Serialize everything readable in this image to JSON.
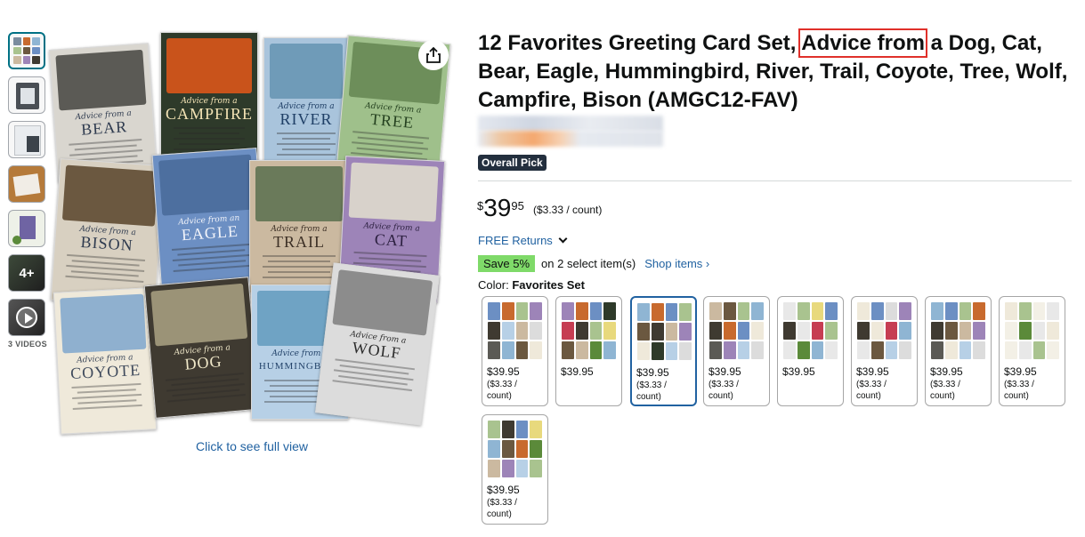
{
  "gallery": {
    "thumbnails": [
      {
        "name": "thumb-1",
        "kind": "image"
      },
      {
        "name": "thumb-2",
        "kind": "image"
      },
      {
        "name": "thumb-3",
        "kind": "image"
      },
      {
        "name": "thumb-4",
        "kind": "image"
      },
      {
        "name": "thumb-5",
        "kind": "image"
      },
      {
        "name": "thumb-more",
        "kind": "more",
        "label": "4+"
      },
      {
        "name": "thumb-video",
        "kind": "video"
      }
    ],
    "videos_label": "3 VIDEOS",
    "see_full_view": "Click to see full view",
    "share_icon": "share-icon",
    "cards": [
      {
        "adv": "Advice from a",
        "name": "BEAR",
        "bg": "#d9d6cf",
        "pic": "#5b5a55",
        "ink": "#2f3b4f"
      },
      {
        "adv": "Advice from a",
        "name": "CAMPFIRE",
        "bg": "#2e3a2a",
        "pic": "#c9531b",
        "ink": "#f3e3b5"
      },
      {
        "adv": "Advice from a",
        "name": "RIVER",
        "bg": "#a9c4dc",
        "pic": "#6f9bb8",
        "ink": "#1f3f66"
      },
      {
        "adv": "Advice from a",
        "name": "TREE",
        "bg": "#9fc08b",
        "pic": "#6d8e5a",
        "ink": "#24401f"
      },
      {
        "adv": "Advice from a",
        "name": "BISON",
        "bg": "#d8d0c1",
        "pic": "#6b5840",
        "ink": "#2f3b4f"
      },
      {
        "adv": "Advice from an",
        "name": "EAGLE",
        "bg": "#6c8fc3",
        "pic": "#4d6f9f",
        "ink": "#f2f4fa"
      },
      {
        "adv": "Advice from a",
        "name": "TRAIL",
        "bg": "#cbb9a0",
        "pic": "#6a7a5a",
        "ink": "#3d3026"
      },
      {
        "adv": "Advice from a",
        "name": "CAT",
        "bg": "#9d84b8",
        "pic": "#d8d2cb",
        "ink": "#2c2040"
      },
      {
        "adv": "Advice from a",
        "name": "COYOTE",
        "bg": "#efe9da",
        "pic": "#8fb0cf",
        "ink": "#3f4a5c"
      },
      {
        "adv": "Advice from a",
        "name": "DOG",
        "bg": "#3f3a31",
        "pic": "#9b9377",
        "ink": "#efe7c8"
      },
      {
        "adv": "Advice from a",
        "name": "HUMMINGBIRD",
        "bg": "#b7d0e6",
        "pic": "#6fa3c4",
        "ink": "#24446b"
      },
      {
        "adv": "Advice from a",
        "name": "WOLF",
        "bg": "#dcdcdc",
        "pic": "#8c8c8c",
        "ink": "#2c2c2c"
      }
    ]
  },
  "product": {
    "title_before": "12 Favorites Greeting Card Set, ",
    "title_highlight": "Advice from",
    "title_after": " a Dog, Cat, Bear, Eagle, Hummingbird, River, Trail, Coyote, Tree, Wolf, Campfire, Bison (AMGC12-FAV)",
    "badge": "Overall Pick",
    "price_symbol": "$",
    "price_whole": "39",
    "price_fraction": "95",
    "price_per_unit": "($3.33 / count)",
    "returns": "FREE Returns",
    "promo_badge": "Save 5%",
    "promo_text": "on 2 select item(s)",
    "shop_items": "Shop items ›",
    "color_label": "Color:",
    "color_value": "Favorites Set",
    "highlight_color": "#e0302a",
    "link_color": "#2162a1"
  },
  "swatches": [
    {
      "price": "$39.95",
      "unit": "($3.33 / count)",
      "selected": false
    },
    {
      "price": "$39.95",
      "unit": "",
      "selected": false
    },
    {
      "price": "$39.95",
      "unit": "($3.33 / count)",
      "selected": true
    },
    {
      "price": "$39.95",
      "unit": "($3.33 / count)",
      "selected": false
    },
    {
      "price": "$39.95",
      "unit": "",
      "selected": false
    },
    {
      "price": "$39.95",
      "unit": "($3.33 / count)",
      "selected": false
    },
    {
      "price": "$39.95",
      "unit": "($3.33 / count)",
      "selected": false
    },
    {
      "price": "$39.95",
      "unit": "($3.33 / count)",
      "selected": false
    },
    {
      "price": "$39.95",
      "unit": "($3.33 / count)",
      "selected": false
    }
  ]
}
